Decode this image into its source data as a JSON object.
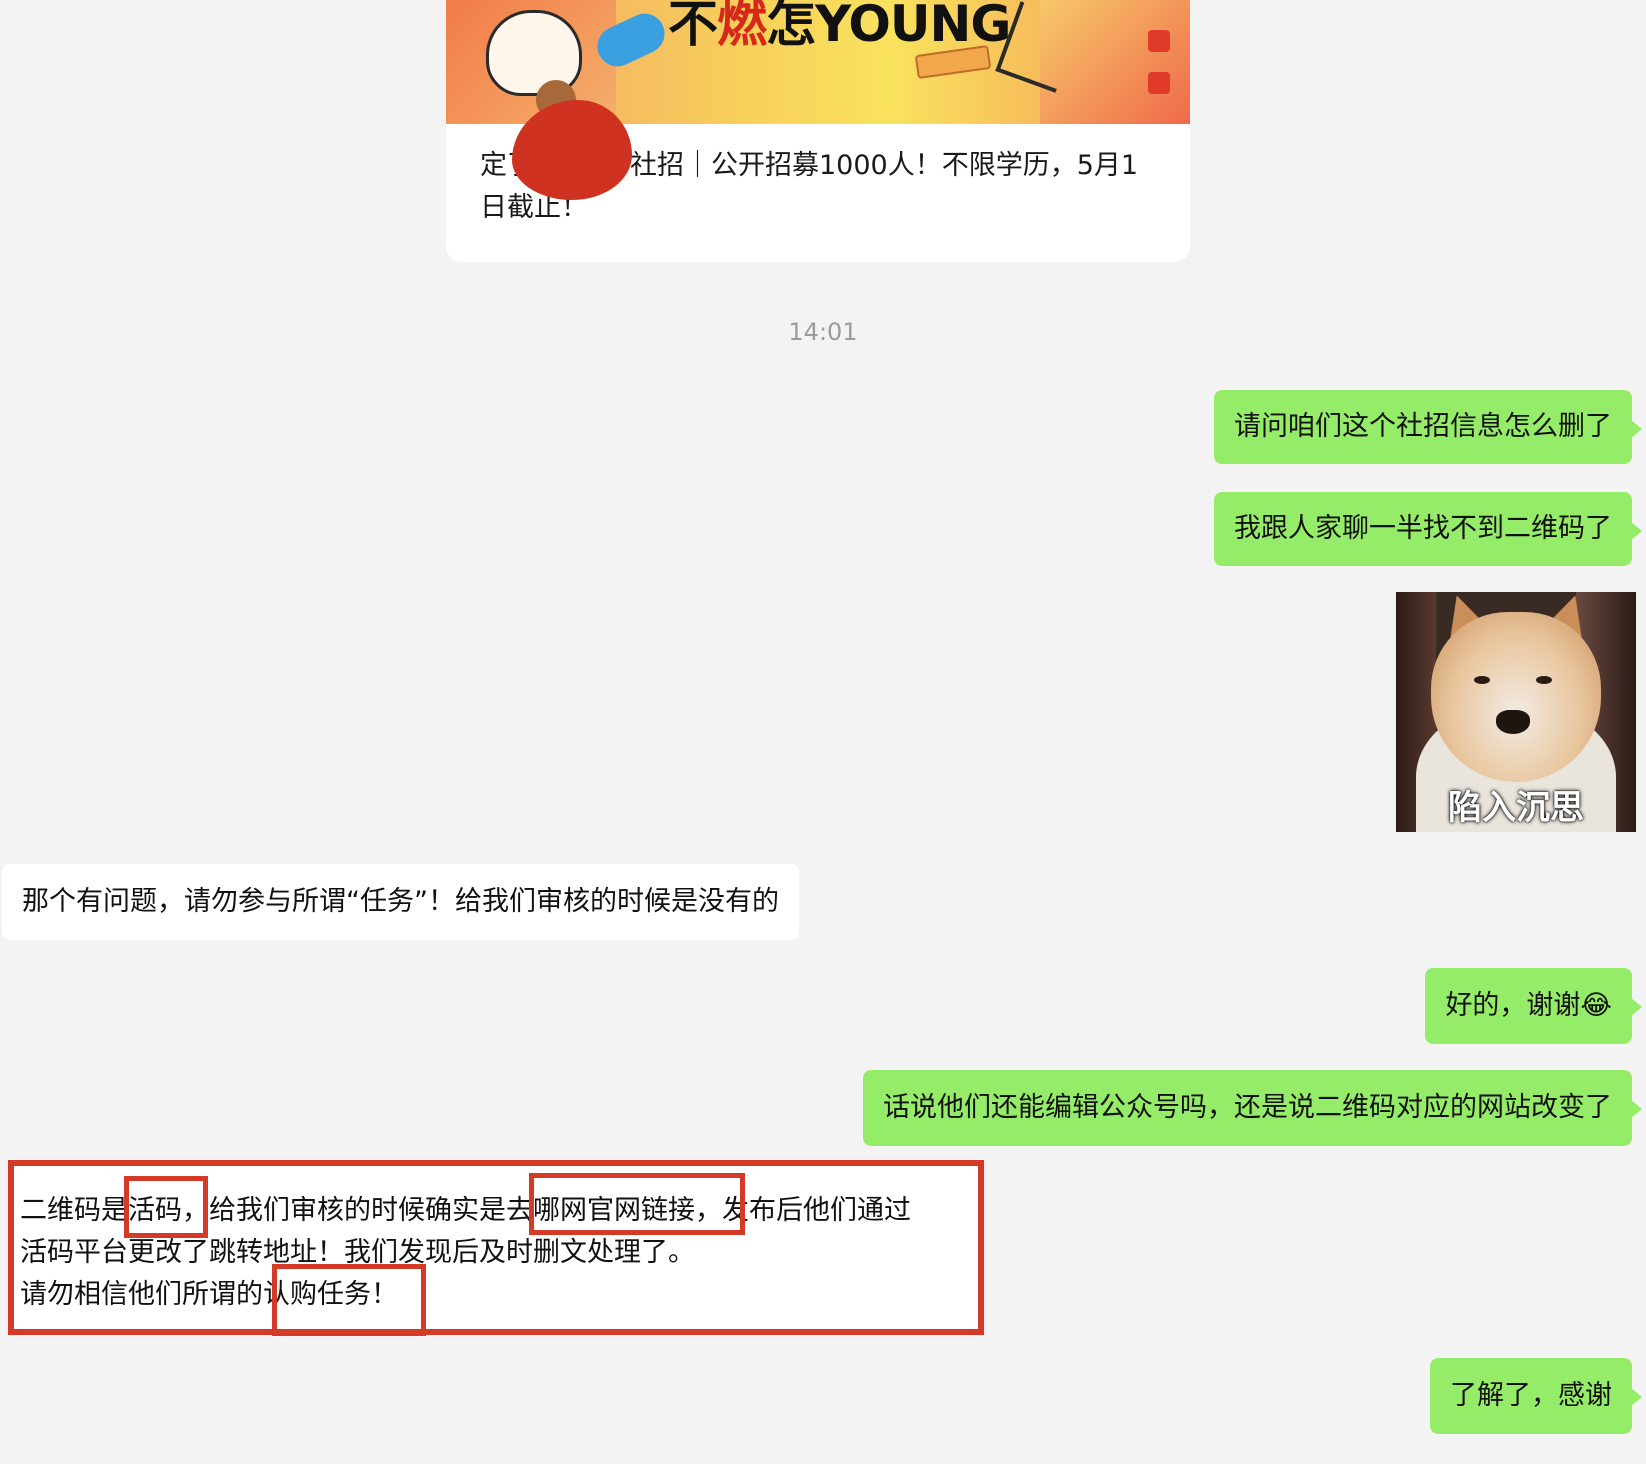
{
  "article_card": {
    "banner_headline_pre": "不",
    "banner_headline_red": "燃",
    "banner_headline_post": "怎YOUNG",
    "title_line1_pre": "定了",
    "title_line1_post": "社招｜公开招募1000人！不限学历，5月1",
    "title_line2": "日截止！"
  },
  "timestamp": "14:01",
  "messages": {
    "m1": "请问咱们这个社招信息怎么删了",
    "m2": "我跟人家聊一半找不到二维码了",
    "sticker_caption": "陷入沉思",
    "m3": "那个有问题，请勿参与所谓“任务”！给我们审核的时候是没有的",
    "m4": "好的，谢谢😂",
    "m5": "话说他们还能编辑公众号吗，还是说二维码对应的网站改变了",
    "reply_line1": "二维码是活码，给我们审核的时候确实是去哪网官网链接，发布后他们通过",
    "reply_line2": "活码平台更改了跳转地址！我们发现后及时删文处理了。",
    "reply_line3": "请勿相信他们所谓的认购任务！",
    "m6": "了解了，感谢"
  },
  "colors": {
    "background": "#f3f3f3",
    "my_bubble": "#95ec69",
    "their_bubble": "#ffffff",
    "highlight_red": "#d43a26",
    "timestamp_gray": "#9b9b9b"
  }
}
